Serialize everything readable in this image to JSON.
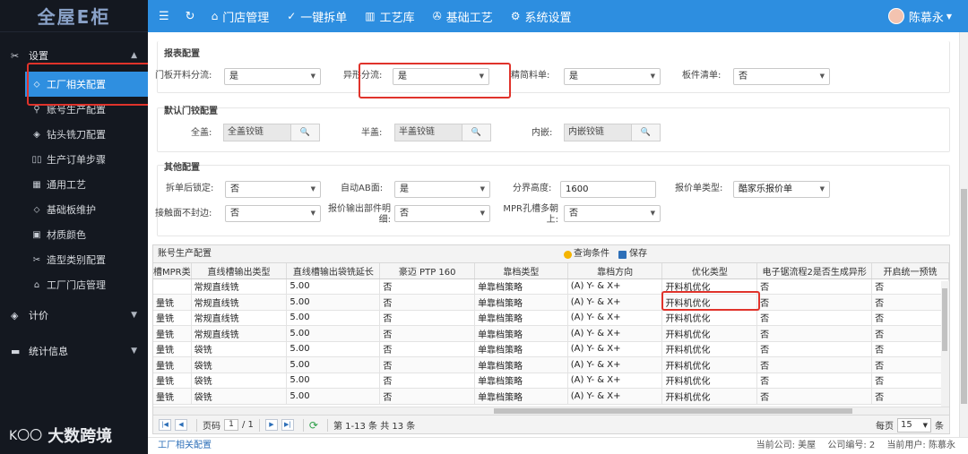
{
  "app": {
    "logo_text": "全屋E柜",
    "brand_footer": "大数跨境",
    "brand_footer_mark": "K〇〇"
  },
  "sidebar": {
    "groups": [
      {
        "label": "设置",
        "icon": "✂"
      },
      {
        "label": "计价",
        "icon": "◈"
      },
      {
        "label": "统计信息",
        "icon": "▬"
      }
    ],
    "items": [
      {
        "label": "工厂相关配置",
        "icon": "⬦",
        "name": "sidebar-item-factory-config"
      },
      {
        "label": "账号生产配置",
        "icon": "⚲",
        "name": "sidebar-item-account-production"
      },
      {
        "label": "钻头铣刀配置",
        "icon": "◈",
        "name": "sidebar-item-drill-config"
      },
      {
        "label": "生产订单步骤",
        "icon": "▯▯",
        "name": "sidebar-item-order-steps"
      },
      {
        "label": "通用工艺",
        "icon": "▦",
        "name": "sidebar-item-common-process"
      },
      {
        "label": "基础板维护",
        "icon": "⬦",
        "name": "sidebar-item-base-board"
      },
      {
        "label": "材质颜色",
        "icon": "▣",
        "name": "sidebar-item-material-color"
      },
      {
        "label": "造型类别配置",
        "icon": "✂",
        "name": "sidebar-item-shape-category"
      },
      {
        "label": "工厂门店管理",
        "icon": "⌂",
        "name": "sidebar-item-store-management"
      }
    ]
  },
  "topbar": {
    "menu_icon": "☰",
    "refresh_icon": "↻",
    "items": [
      {
        "label": "门店管理",
        "icon": "⌂"
      },
      {
        "label": "一键拆单",
        "icon": "✓"
      },
      {
        "label": "工艺库",
        "icon": "▥"
      },
      {
        "label": "基础工艺",
        "icon": "✇"
      },
      {
        "label": "系统设置",
        "icon": "⚙"
      }
    ],
    "user": "陈慕永"
  },
  "report_config": {
    "title": "报表配置",
    "fields": [
      {
        "label": "门板开料分流:",
        "value": "是"
      },
      {
        "label": "异形分流:",
        "value": "是"
      },
      {
        "label": "精简料单:",
        "value": "是"
      },
      {
        "label": "板件清单:",
        "value": "否"
      }
    ]
  },
  "hinge_config": {
    "title": "默认门铰配置",
    "fields": [
      {
        "label": "全盖:",
        "value": "全盖铰链"
      },
      {
        "label": "半盖:",
        "value": "半盖铰链"
      },
      {
        "label": "内嵌:",
        "value": "内嵌铰链"
      }
    ]
  },
  "other_config": {
    "title": "其他配置",
    "fields": [
      {
        "label": "拆单后锁定:",
        "value": "否"
      },
      {
        "label": "自动AB面:",
        "value": "是"
      },
      {
        "label": "分界高度:",
        "value": "1600"
      },
      {
        "label": "报价单类型:",
        "value": "酷家乐报价单"
      },
      {
        "label": "接触面不封边:",
        "value": "否"
      },
      {
        "label": "报价输出部件明细:",
        "value": "否"
      },
      {
        "label": "MPR孔槽多朝上:",
        "value": "否"
      }
    ]
  },
  "grid": {
    "caption": "账号生产配置",
    "query_label": "查询条件",
    "save_label": "保存",
    "columns": [
      "槽MPR类",
      "直线槽输出类型",
      "直线槽输出袋铣延长",
      "豪迈 PTP 160",
      "靠档类型",
      "靠档方向",
      "优化类型",
      "电子锯流程2是否生成异形",
      "开启统一预铣"
    ],
    "rows": [
      [
        "",
        "常规直线铣",
        "5.00",
        "否",
        "单靠档策略",
        "(A) Y- & X+",
        "开料机优化",
        "否",
        "否"
      ],
      [
        "量铣",
        "常规直线铣",
        "5.00",
        "否",
        "单靠档策略",
        "(A) Y- & X+",
        "开料机优化",
        "否",
        "否"
      ],
      [
        "量铣",
        "常规直线铣",
        "5.00",
        "否",
        "单靠档策略",
        "(A) Y- & X+",
        "开料机优化",
        "否",
        "否"
      ],
      [
        "量铣",
        "常规直线铣",
        "5.00",
        "否",
        "单靠档策略",
        "(A) Y- & X+",
        "开料机优化",
        "否",
        "否"
      ],
      [
        "量铣",
        "袋铣",
        "5.00",
        "否",
        "单靠档策略",
        "(A) Y- & X+",
        "开料机优化",
        "否",
        "否"
      ],
      [
        "量铣",
        "袋铣",
        "5.00",
        "否",
        "单靠档策略",
        "(A) Y- & X+",
        "开料机优化",
        "否",
        "否"
      ],
      [
        "量铣",
        "袋铣",
        "5.00",
        "否",
        "单靠档策略",
        "(A) Y- & X+",
        "开料机优化",
        "否",
        "否"
      ],
      [
        "量铣",
        "袋铣",
        "5.00",
        "否",
        "单靠档策略",
        "(A) Y- & X+",
        "开料机优化",
        "否",
        "否"
      ]
    ],
    "pager": {
      "page_label": "页码",
      "page_value": "1",
      "total_pages": "/ 1",
      "range_text": "第 1-13 条  共 13 条",
      "per_page_label": "每页",
      "per_page_value": "15",
      "suffix": "条"
    }
  },
  "statusbar": {
    "breadcrumb": "工厂相关配置",
    "company": "当前公司: 美屋",
    "company_no": "公司编号: 2",
    "current_user": "当前用户: 陈慕永"
  },
  "colors": {
    "accent": "#2d8ee0",
    "sidebar_bg": "#141820",
    "highlight": "#e0332b"
  }
}
